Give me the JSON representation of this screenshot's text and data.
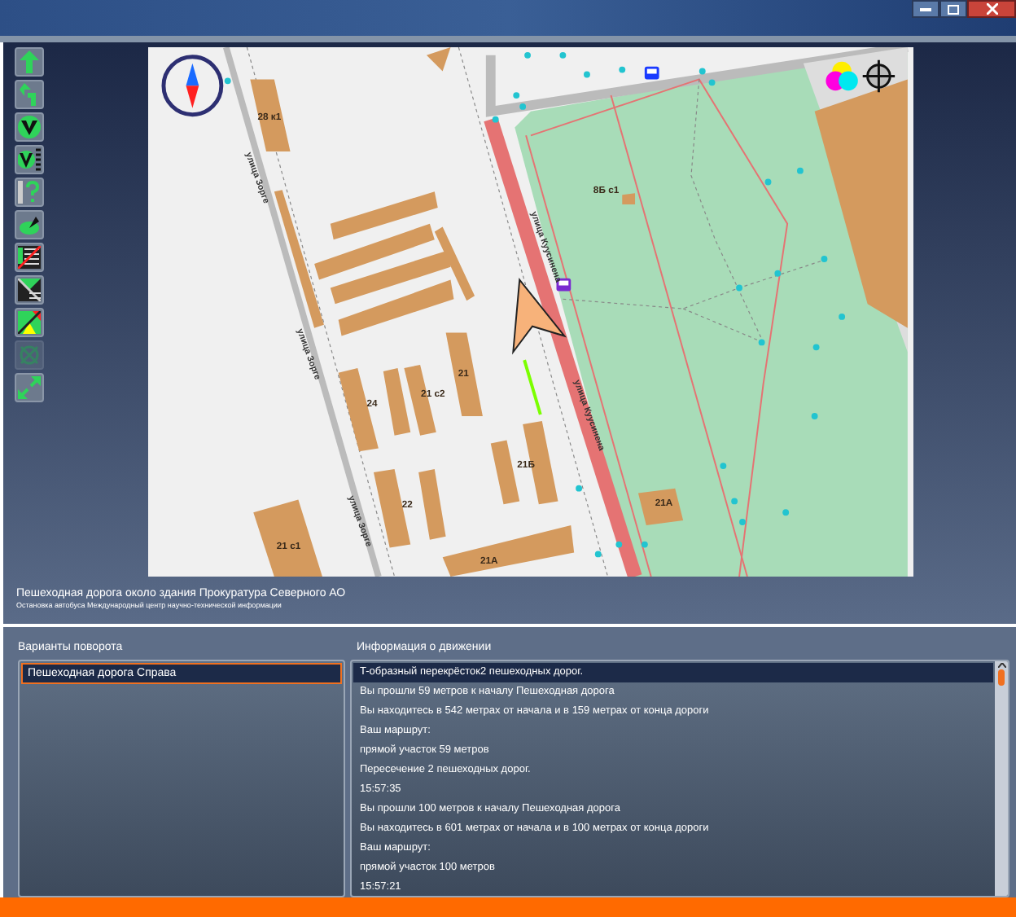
{
  "toolbar": [
    {
      "kind": "straight",
      "disabled": false
    },
    {
      "kind": "uturn",
      "disabled": false
    },
    {
      "kind": "fork",
      "disabled": false
    },
    {
      "kind": "fork-list",
      "disabled": false
    },
    {
      "kind": "question",
      "disabled": false
    },
    {
      "kind": "radar",
      "disabled": false
    },
    {
      "kind": "list-off",
      "disabled": false
    },
    {
      "kind": "list-split",
      "disabled": false
    },
    {
      "kind": "warning",
      "disabled": false
    },
    {
      "kind": "target",
      "disabled": true
    },
    {
      "kind": "expand",
      "disabled": false
    }
  ],
  "map": {
    "labels": [
      {
        "kind": "building",
        "text": "28 к1"
      },
      {
        "kind": "street",
        "text": "улица Зорге"
      },
      {
        "kind": "street",
        "text": "улица Зорге"
      },
      {
        "kind": "street",
        "text": "улица Зорге"
      },
      {
        "kind": "street",
        "text": "улица Куусинена"
      },
      {
        "kind": "street",
        "text": "улица Куусинена"
      },
      {
        "kind": "building",
        "text": "8Б с1"
      },
      {
        "kind": "building",
        "text": "21"
      },
      {
        "kind": "building",
        "text": "21 с2"
      },
      {
        "kind": "building",
        "text": "24"
      },
      {
        "kind": "building",
        "text": "21Б"
      },
      {
        "kind": "building",
        "text": "22"
      },
      {
        "kind": "building",
        "text": "21 с1"
      },
      {
        "kind": "building",
        "text": "21А"
      },
      {
        "kind": "building",
        "text": "21А"
      }
    ]
  },
  "location": {
    "title": "Пешеходная дорога около здания Прокуратура Северного АО",
    "subtitle": "Остановка автобуса Международный центр научно-технической информации"
  },
  "turn_options": {
    "label": "Варианты поворота",
    "items": [
      {
        "text": "Пешеходная дорога  Справа",
        "selected": true
      }
    ]
  },
  "movement_info": {
    "label": "Информация о движении",
    "items": [
      {
        "text": "T-образный перекрёсток2 пешеходных дорог.",
        "selected": true
      },
      {
        "text": "Вы прошли 59 метров к началу Пешеходная дорога",
        "selected": false
      },
      {
        "text": "Вы находитесь в 542 метрах  от начала и в 159 метрах  от конца дороги",
        "selected": false
      },
      {
        "text": "Ваш маршрут:",
        "selected": false
      },
      {
        "text": "прямой участок 59 метров",
        "selected": false
      },
      {
        "text": "Пересечение 2 пешеходных дорог.",
        "selected": false
      },
      {
        "text": "15:57:35",
        "selected": false
      },
      {
        "text": "Вы прошли 100 метров к началу Пешеходная дорога",
        "selected": false
      },
      {
        "text": "Вы находитесь в 601 метрах  от начала и в 100 метрах  от конца дороги",
        "selected": false
      },
      {
        "text": "Ваш маршрут:",
        "selected": false
      },
      {
        "text": "прямой участок 100 метров",
        "selected": false
      },
      {
        "text": "15:57:21",
        "selected": false
      }
    ]
  }
}
